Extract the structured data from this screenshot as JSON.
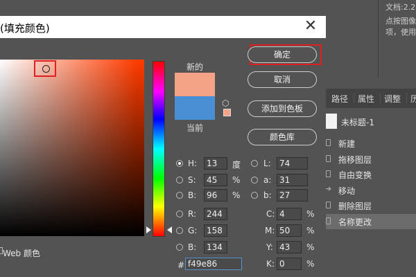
{
  "background_app": {
    "top_lines": [
      "文档:2.2",
      "点按图像",
      "项，使用"
    ],
    "panel_tabs": [
      "路径",
      "属性",
      "调整",
      "历"
    ],
    "snapshot_label": "未标题-1",
    "history_items": [
      "新建",
      "拖移图层",
      "自由变换",
      "移动",
      "删除图层",
      "名称更改"
    ]
  },
  "dialog": {
    "title": "(填充颜色)",
    "close_glyph": "✕",
    "new_label": "新的",
    "current_label": "当前",
    "new_color": "#f49e86",
    "current_color": "#4a8fd4",
    "buttons": {
      "ok": "确定",
      "cancel": "取消",
      "add_swatch": "添加到色板",
      "color_library": "颜色库"
    },
    "hsb": {
      "h_label": "H:",
      "h_value": "13",
      "h_unit": "度",
      "s_label": "S:",
      "s_value": "45",
      "s_unit": "%",
      "b_label": "B:",
      "b_value": "96",
      "b_unit": "%"
    },
    "lab": {
      "l_label": "L:",
      "l_value": "74",
      "a_label": "a:",
      "a_value": "31",
      "b_label": "b:",
      "b_value": "27"
    },
    "rgb": {
      "r_label": "R:",
      "r_value": "244",
      "g_label": "G:",
      "g_value": "158",
      "b_label": "B:",
      "b_value": "134"
    },
    "cmyk": {
      "c_label": "C:",
      "c_value": "4",
      "m_label": "M:",
      "m_value": "50",
      "y_label": "Y:",
      "y_value": "43",
      "k_label": "K:",
      "k_value": "0",
      "unit": "%"
    },
    "hex_label": "#",
    "hex_value": "f49e86",
    "web_colors_label": "Web 颜色"
  },
  "colors": {
    "dialog_bg": "#535353",
    "highlight": "#e02020"
  }
}
